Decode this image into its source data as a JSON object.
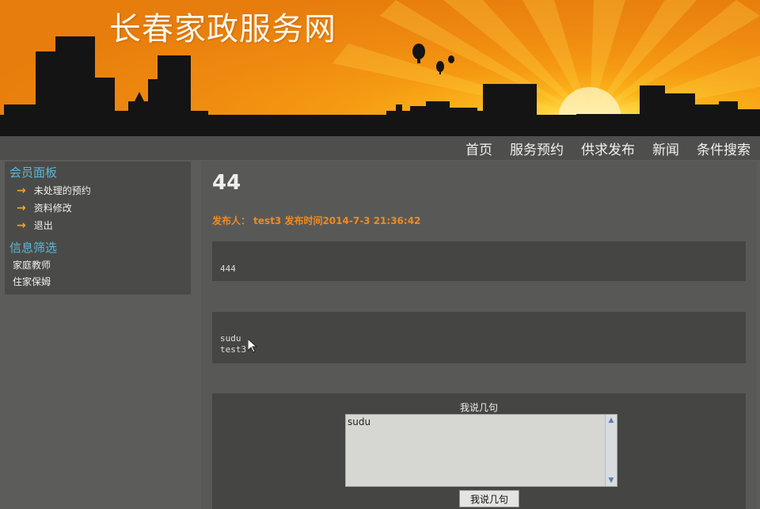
{
  "site": {
    "title": "长春家政服务网"
  },
  "nav": {
    "items": [
      "首页",
      "服务预约",
      "供求发布",
      "新闻",
      "条件搜索"
    ]
  },
  "sidebar": {
    "member_heading": "会员面板",
    "member_items": [
      "未处理的预约",
      "资料修改",
      "退出"
    ],
    "filter_heading": "信息筛选",
    "filter_items": [
      "家庭教师",
      "住家保姆"
    ]
  },
  "post": {
    "title": "44",
    "meta": "发布人：  test3 发布时间2014-7-3 21:36:42",
    "content": "444",
    "comments": [
      "sudu",
      "test3"
    ]
  },
  "comment_form": {
    "label": "我说几句",
    "textarea_value": "sudu",
    "submit_label": "我说几句"
  },
  "colors": {
    "accent_orange": "#f28a1e",
    "heading_blue": "#5fb7d8",
    "arrow_orange": "#f5a623"
  }
}
